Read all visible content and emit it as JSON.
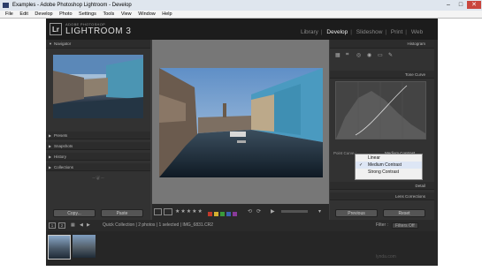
{
  "window": {
    "title": "Examples - Adobe Photoshop Lightroom - Develop",
    "controls": [
      "–",
      "□",
      "✕"
    ]
  },
  "menu": [
    "File",
    "Edit",
    "Develop",
    "Photo",
    "Settings",
    "Tools",
    "View",
    "Window",
    "Help"
  ],
  "identity": {
    "small": "ADOBE PHOTOSHOP",
    "big": "LIGHTROOM 3",
    "badge": "Lr"
  },
  "modules": {
    "library": "Library",
    "develop": "Develop",
    "slideshow": "Slideshow",
    "print": "Print",
    "web": "Web",
    "sep": "|"
  },
  "left": {
    "navigator": "Navigator",
    "presets": "Presets",
    "snapshots": "Snapshots",
    "history": "History",
    "collections": "Collections",
    "copy": "Copy...",
    "paste": "Paste"
  },
  "right": {
    "histogram": "Histogram",
    "tone_curve": "Tone Curve",
    "point_curve_label": "Point Curve :",
    "point_curve_value": "Medium Contrast",
    "detail": "Detail",
    "lens_corrections": "Lens Corrections",
    "previous": "Previous",
    "reset": "Reset",
    "dropdown_items": [
      {
        "label": "Linear",
        "checked": false
      },
      {
        "label": "Medium Contrast",
        "checked": true
      },
      {
        "label": "Strong Contrast",
        "checked": false
      }
    ]
  },
  "toolbar": {
    "stars": "★★★★★",
    "flag_colors": [
      "#c0392b",
      "#d4b030",
      "#3a9a3a",
      "#3a60b0",
      "#8a3a9a"
    ]
  },
  "filmstrip": {
    "pages": [
      "1",
      "2"
    ],
    "info": "Quick Collection | 2 photos | 1 selected | IMG_6831.CR2",
    "filter_label": "Filter :",
    "filter_value": "Filters Off"
  },
  "watermark": "lynda.com"
}
